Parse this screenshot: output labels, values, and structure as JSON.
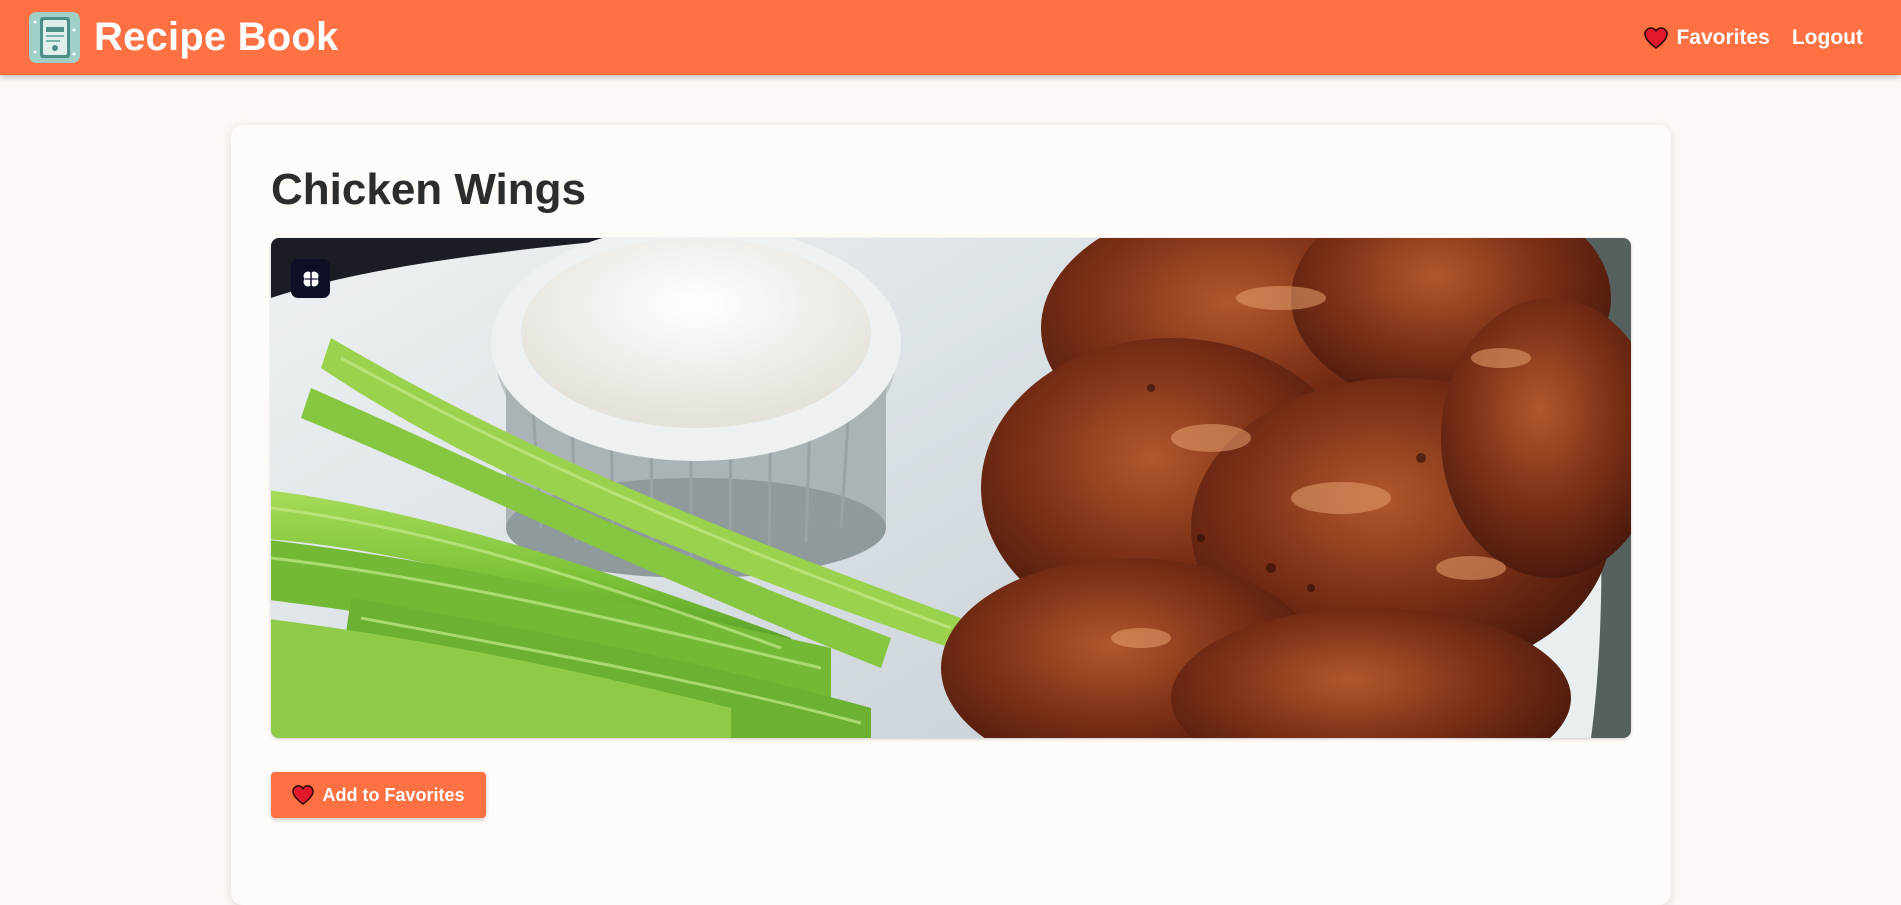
{
  "header": {
    "app_title": "Recipe Book",
    "logo_icon": "recipe-book-logo-icon",
    "nav": {
      "favorites_label": "Favorites",
      "favorites_icon": "heart-icon",
      "logout_label": "Logout"
    },
    "brand_color": "#ff7043"
  },
  "recipe": {
    "title": "Chicken Wings",
    "image_alt": "Chicken wings with celery sticks and dip",
    "image_badge_icon": "brain-icon",
    "add_favorite_label": "Add to Favorites",
    "add_favorite_icon": "heart-icon"
  }
}
